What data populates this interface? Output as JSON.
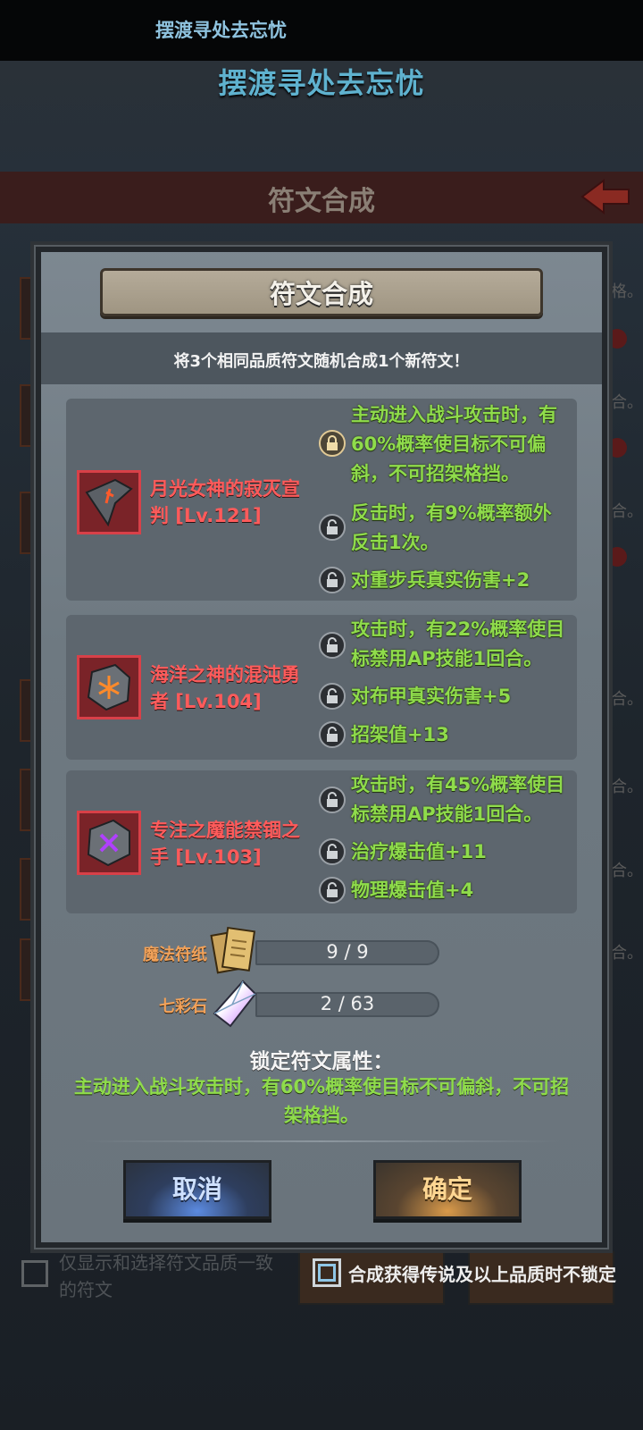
{
  "status_bar": {
    "title": "摆渡寻处去忘忧"
  },
  "app": {
    "title": "摆渡寻处去忘忧"
  },
  "background": {
    "header_title": "符文合成",
    "side_texts": [
      "格。",
      "合。",
      "合。",
      "合。",
      "合。",
      "合。",
      "合。"
    ],
    "filter_label": "仅显示和选择符文品质一致的符文"
  },
  "modal": {
    "title": "符文合成",
    "subtitle": "将3个相同品质符文随机合成1个新符文！",
    "runes": [
      {
        "name": "月光女神的寂灭宣判 [Lv.121]",
        "icon": "rune-shard-red-icon",
        "attributes": [
          {
            "text": "主动进入战斗攻击时，有60%概率使目标不可偏斜，不可招架格挡。",
            "locked": true
          },
          {
            "text": "反击时，有9%概率额外反击1次。",
            "locked": false
          },
          {
            "text": "对重步兵真实伤害+2",
            "locked": false
          }
        ]
      },
      {
        "name": "海洋之神的混沌勇者 [Lv.104]",
        "icon": "rune-stone-orange-icon",
        "attributes": [
          {
            "text": "攻击时，有22%概率使目标禁用AP技能1回合。",
            "locked": false
          },
          {
            "text": "对布甲真实伤害+5",
            "locked": false
          },
          {
            "text": "招架值+13",
            "locked": false
          }
        ]
      },
      {
        "name": "专注之魔能禁锢之手 [Lv.103]",
        "icon": "rune-stone-purple-icon",
        "attributes": [
          {
            "text": "攻击时，有45%概率使目标禁用AP技能1回合。",
            "locked": false
          },
          {
            "text": "治疗爆击值+11",
            "locked": false
          },
          {
            "text": "物理爆击值+4",
            "locked": false
          }
        ]
      }
    ],
    "resources": [
      {
        "label": "魔法符纸",
        "value": "9 / 9",
        "icon": "scroll-paper-icon"
      },
      {
        "label": "七彩石",
        "value": "2 / 63",
        "icon": "rainbow-crystal-icon"
      }
    ],
    "lock_title": "锁定符文属性：",
    "lock_desc": "主动进入战斗攻击时，有60%概率使目标不可偏斜，不可招架格挡。",
    "cancel_label": "取消",
    "confirm_label": "确定"
  },
  "bottom_option": {
    "label": "合成获得传说及以上品质时不锁定"
  }
}
